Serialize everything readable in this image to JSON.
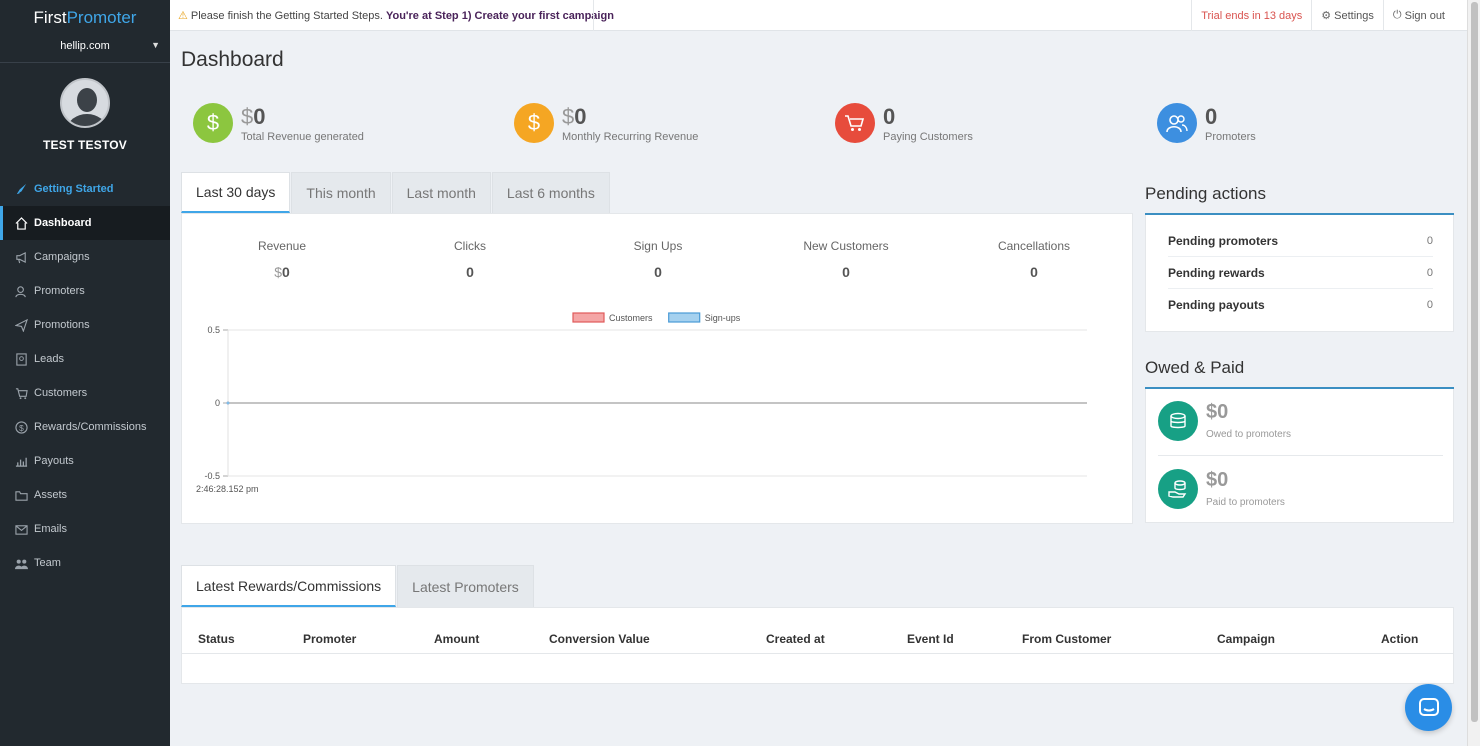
{
  "brand": {
    "first": "First",
    "second": "Promoter"
  },
  "site_select": {
    "value": "hellip.com"
  },
  "user": {
    "name": "TEST TESTOV"
  },
  "sidebar": {
    "items": [
      {
        "label": "Getting Started",
        "icon": "rocket-icon"
      },
      {
        "label": "Dashboard",
        "icon": "home-icon"
      },
      {
        "label": "Campaigns",
        "icon": "megaphone-icon"
      },
      {
        "label": "Promoters",
        "icon": "users-icon"
      },
      {
        "label": "Promotions",
        "icon": "paper-plane-icon"
      },
      {
        "label": "Leads",
        "icon": "contact-card-icon"
      },
      {
        "label": "Customers",
        "icon": "cart-icon"
      },
      {
        "label": "Rewards/Commissions",
        "icon": "dollar-circle-icon"
      },
      {
        "label": "Payouts",
        "icon": "payout-icon"
      },
      {
        "label": "Assets",
        "icon": "folder-icon"
      },
      {
        "label": "Emails",
        "icon": "envelope-icon"
      },
      {
        "label": "Team",
        "icon": "team-icon"
      }
    ]
  },
  "topbar": {
    "notice": "Please finish the Getting Started Steps.",
    "notice_strong": "You're at Step 1) Create your first campaign",
    "trial": "Trial ends in 13 days",
    "settings": "Settings",
    "signout": "Sign out"
  },
  "page_title": "Dashboard",
  "stats": [
    {
      "currency": "$",
      "value": "0",
      "label": "Total Revenue generated",
      "color": "#8cc63f"
    },
    {
      "currency": "$",
      "value": "0",
      "label": "Monthly Recurring Revenue",
      "color": "#f5a623"
    },
    {
      "currency": "",
      "value": "0",
      "label": "Paying Customers",
      "color": "#e74c3c"
    },
    {
      "currency": "",
      "value": "0",
      "label": "Promoters",
      "color": "#3d8fe0"
    }
  ],
  "tabs": [
    "Last 30 days",
    "This month",
    "Last month",
    "Last 6 months"
  ],
  "metrics": [
    {
      "label": "Revenue",
      "currency": "$",
      "value": "0"
    },
    {
      "label": "Clicks",
      "currency": "",
      "value": "0"
    },
    {
      "label": "Sign Ups",
      "currency": "",
      "value": "0"
    },
    {
      "label": "New Customers",
      "currency": "",
      "value": "0"
    },
    {
      "label": "Cancellations",
      "currency": "",
      "value": "0"
    }
  ],
  "chart_data": {
    "type": "line",
    "series": [
      {
        "name": "Customers",
        "values": [
          0
        ],
        "color": "#f08080"
      },
      {
        "name": "Sign-ups",
        "values": [
          0
        ],
        "color": "#7fbde8"
      }
    ],
    "x": [
      "2:46:28.152 pm"
    ],
    "y_ticks": [
      "0.5",
      "0",
      "-0.5"
    ],
    "ylim": [
      -0.5,
      0.5
    ],
    "legend": "top"
  },
  "pending": {
    "title": "Pending actions",
    "rows": [
      {
        "label": "Pending promoters",
        "value": "0"
      },
      {
        "label": "Pending rewards",
        "value": "0"
      },
      {
        "label": "Pending payouts",
        "value": "0"
      }
    ]
  },
  "owed": {
    "title": "Owed & Paid",
    "items": [
      {
        "value": "$0",
        "label": "Owed to promoters"
      },
      {
        "value": "$0",
        "label": "Paid to promoters"
      }
    ]
  },
  "bottom_tabs": [
    "Latest Rewards/Commissions",
    "Latest Promoters"
  ],
  "table": {
    "columns": [
      "Status",
      "Promoter",
      "Amount",
      "Conversion Value",
      "Created at",
      "Event Id",
      "From Customer",
      "Campaign",
      "Action"
    ]
  }
}
